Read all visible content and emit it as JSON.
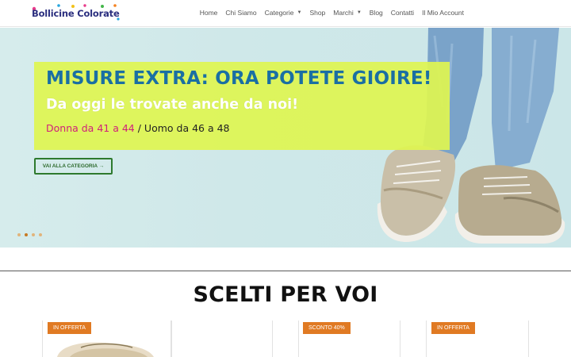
{
  "header": {
    "logo_text": "Bollicine Colorate",
    "nav": [
      {
        "label": "Home",
        "has_caret": false
      },
      {
        "label": "Chi Siamo",
        "has_caret": false
      },
      {
        "label": "Categorie",
        "has_caret": true
      },
      {
        "label": "Shop",
        "has_caret": false
      },
      {
        "label": "Marchi",
        "has_caret": true
      },
      {
        "label": "Blog",
        "has_caret": false
      },
      {
        "label": "Contatti",
        "has_caret": false
      },
      {
        "label": "Il Mio Account",
        "has_caret": false
      }
    ]
  },
  "hero": {
    "title": "MISURE EXTRA: ORA POTETE GIOIRE!",
    "subtitle": "Da oggi le trovate anche da noi!",
    "sizes_women": "Donna da 41 a 44",
    "sizes_separator": " / ",
    "sizes_men": "Uomo da 46 a 48",
    "cta_label": "VAI ALLA CATEGORIA →",
    "slides_count": 4,
    "active_slide": 2,
    "colors": {
      "title": "#1a6fa3",
      "promo_bg": "#dcf357",
      "women": "#d0207a",
      "cta_border": "#2e7a2e"
    }
  },
  "section": {
    "title": "SCELTI PER VOI"
  },
  "products": [
    {
      "badge": "IN OFFERTA"
    },
    {
      "badge": ""
    },
    {
      "badge": "SCONTO 40%"
    },
    {
      "badge": "IN OFFERTA"
    }
  ],
  "badge_color": "#e07a23"
}
